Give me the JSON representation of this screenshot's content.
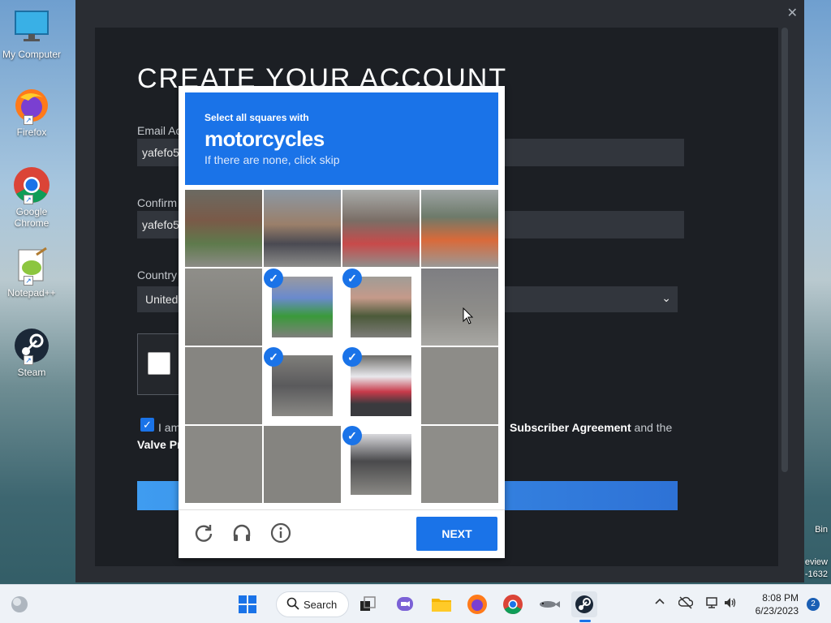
{
  "desktop": {
    "icons": [
      {
        "label": "My Computer",
        "icon": "monitor-icon"
      },
      {
        "label": "Firefox",
        "icon": "firefox-icon"
      },
      {
        "label": "Google Chrome",
        "icon": "chrome-icon"
      },
      {
        "label": "Notepad++",
        "icon": "notepadpp-icon"
      },
      {
        "label": "Steam",
        "icon": "steam-icon"
      }
    ],
    "edge_labels": [
      "Bin",
      "eview",
      "-1632"
    ]
  },
  "steam": {
    "close": "✕",
    "title": "CREATE YOUR ACCOUNT",
    "email_label": "Email Ac",
    "email_value": "yafefo5",
    "confirm_label": "Confirm",
    "confirm_value": "yafefo5",
    "country_label": "Country",
    "country_value": "United",
    "agree_prefix": "I am",
    "agree_link": "Subscriber Agreement",
    "agree_suffix": "and the",
    "privacy_text": "Valve Pr"
  },
  "captcha": {
    "instruction": "Select all squares with",
    "target": "motorcycles",
    "skip_hint": "If there are none, click skip",
    "tiles_selected": [
      5,
      6,
      9,
      10,
      14
    ],
    "next_label": "NEXT",
    "footer_icons": [
      "reload-icon",
      "audio-icon",
      "info-icon"
    ]
  },
  "taskbar": {
    "search_label": "Search",
    "time": "8:08 PM",
    "date": "6/23/2023",
    "notification_count": "2"
  },
  "colors": {
    "accent": "#1a73e8",
    "steam_bg": "#1c1f24"
  }
}
